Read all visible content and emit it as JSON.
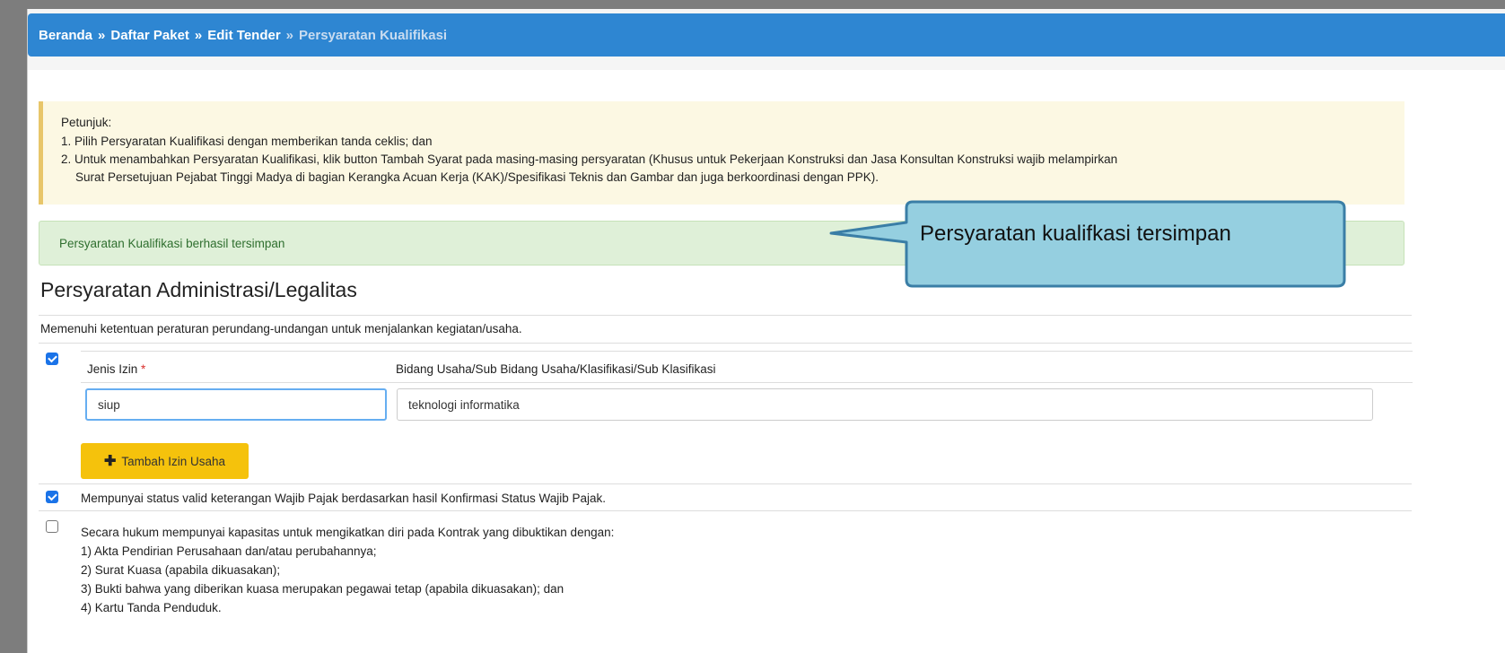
{
  "breadcrumb": {
    "items": [
      "Beranda",
      "Daftar Paket",
      "Edit Tender"
    ],
    "current": "Persyaratan Kualifikasi",
    "separator": "»"
  },
  "hint": {
    "title": "Petunjuk:",
    "line1": "1. Pilih Persyaratan Kualifikasi dengan memberikan tanda ceklis; dan",
    "line2": "2. Untuk menambahkan Persyaratan Kualifikasi, klik button Tambah Syarat pada masing-masing persyaratan (Khusus untuk Pekerjaan Konstruksi dan Jasa Konsultan Konstruksi wajib melampirkan",
    "line2b": "Surat Persetujuan Pejabat Tinggi Madya di bagian Kerangka Acuan Kerja (KAK)/Spesifikasi Teknis dan Gambar dan juga berkoordinasi dengan PPK)."
  },
  "success_message": "Persyaratan Kualifikasi berhasil tersimpan",
  "callout_text": "Persyaratan kualifkasi tersimpan",
  "section": {
    "title": "Persyaratan Administrasi/Legalitas",
    "description": "Memenuhi ketentuan peraturan perundang-undangan untuk menjalankan kegiatan/usaha."
  },
  "izin": {
    "jenis_label": "Jenis Izin",
    "required_mark": "*",
    "bidang_label": "Bidang Usaha/Sub Bidang Usaha/Klasifikasi/Sub Klasifikasi",
    "jenis_value": "siup",
    "bidang_value": "teknologi informatika",
    "add_button": "Tambah Izin Usaha",
    "checked": true
  },
  "pajak": {
    "text": "Mempunyai status valid keterangan Wajib Pajak berdasarkan hasil Konfirmasi Status Wajib Pajak.",
    "checked": true
  },
  "hukum": {
    "text": "Secara hukum mempunyai kapasitas untuk mengikatkan diri pada Kontrak yang dibuktikan dengan:",
    "items": [
      "1) Akta Pendirian Perusahaan dan/atau perubahannya;",
      "2) Surat Kuasa (apabila dikuasakan);",
      "3) Bukti bahwa yang diberikan kuasa merupakan pegawai tetap (apabila dikuasakan); dan",
      "4) Kartu Tanda Penduduk."
    ],
    "checked": false
  }
}
